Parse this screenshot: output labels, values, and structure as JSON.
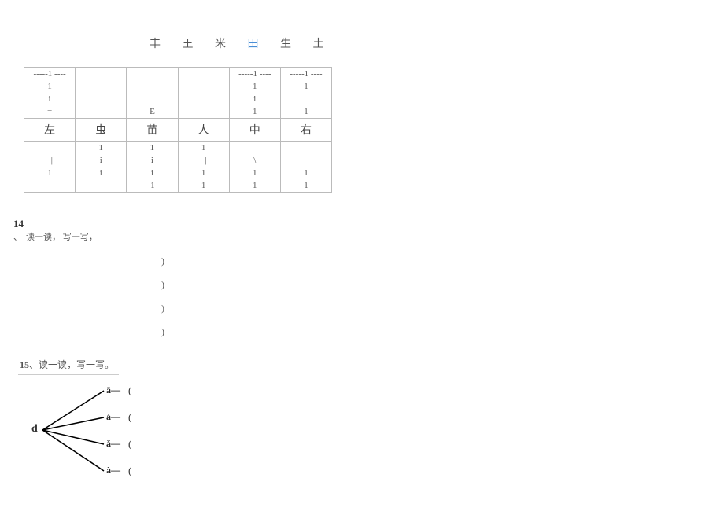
{
  "top_chars": {
    "c1": "丰",
    "c2": "王",
    "c3": "米",
    "c4": "田",
    "c5": "生",
    "c6": "土"
  },
  "table": {
    "row_top_dashes": "-----1 ----",
    "one": "1",
    "i": "i",
    "e": "E",
    "bar": "=",
    "chars": {
      "c1": "左",
      "c2": "虫",
      "c3": "苗",
      "c4": "人",
      "c5": "中",
      "c6": "右"
    },
    "underscore_i": "_|",
    "slash": "\\"
  },
  "q14": {
    "num": "14",
    "dun": "、",
    "text": "读一读， 写一写，",
    "paren": ")"
  },
  "q15": {
    "num": "15",
    "text": "、读一读，写一写。",
    "root": "d",
    "b1": "ā",
    "b2": "á",
    "b3": "ǎ",
    "b4": "à",
    "dash": "—",
    "paren": "("
  }
}
